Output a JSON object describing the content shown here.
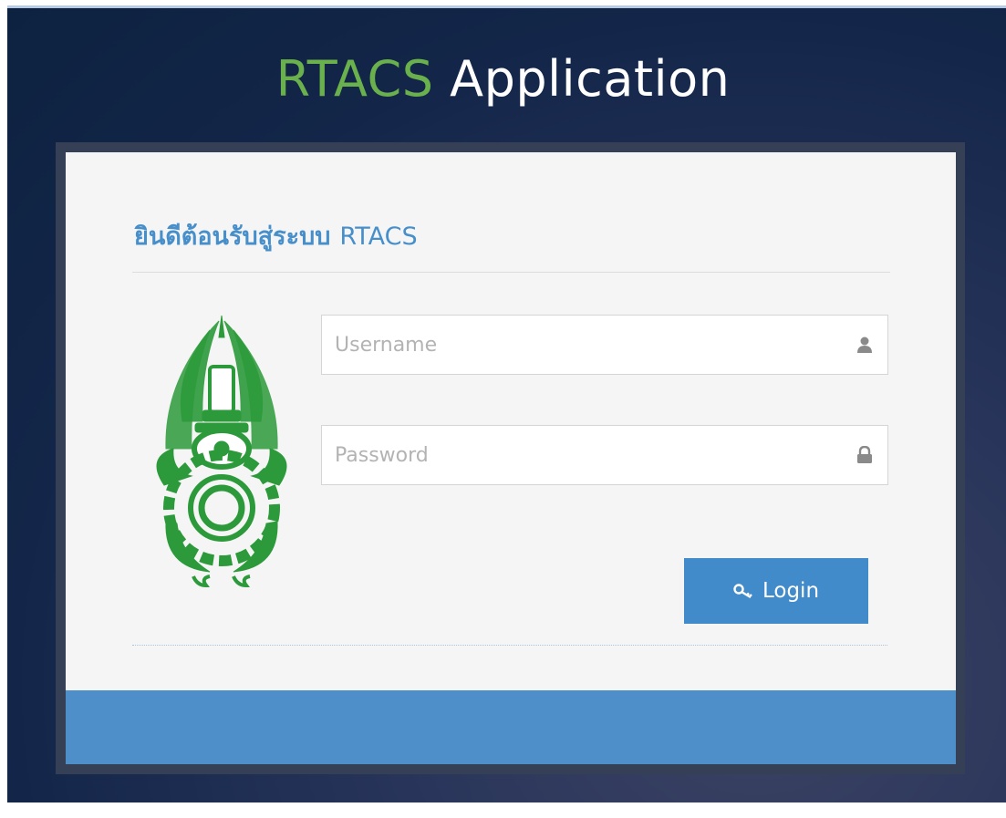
{
  "app": {
    "title_accent": "RTACS",
    "title_rest": " Application"
  },
  "login": {
    "welcome_thai": "ยินดีต้อนรับสู่ระบบ",
    "welcome_system": "RTACS",
    "username_placeholder": "Username",
    "username_value": "",
    "password_placeholder": "Password",
    "password_value": "",
    "login_label": "Login"
  },
  "icons": {
    "username": "user-icon",
    "password": "lock-icon",
    "login": "key-icon",
    "emblem": "royal-emblem-icon"
  },
  "colors": {
    "accent_green": "#6ab04c",
    "primary_blue": "#428bca",
    "footer_blue": "#4e8fc9",
    "emblem_green": "#2c9a3a"
  }
}
